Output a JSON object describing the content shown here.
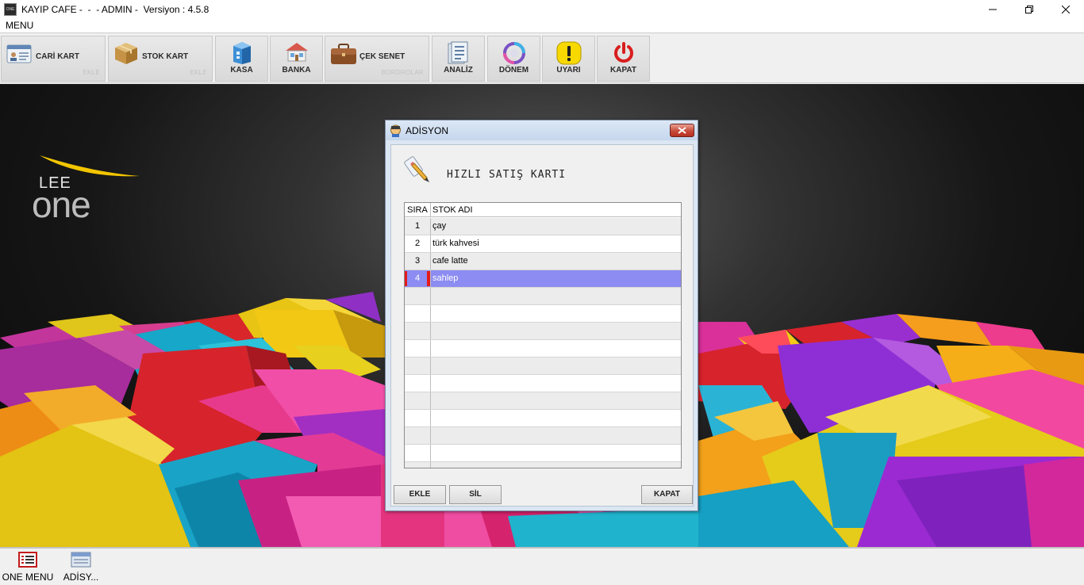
{
  "window": {
    "title": "KAYIP CAFE -  -  - ADMIN -  Versiyon : 4.5.8",
    "app_icon_text": "ONE"
  },
  "menubar": {
    "menu_label": "MENU"
  },
  "toolbar": {
    "cari_kart": {
      "label": "CARİ KART",
      "sub": "EKLE",
      "icon": "contact-card-icon"
    },
    "stok_kart": {
      "label": "STOK KART",
      "sub": "EKLE",
      "icon": "box-icon"
    },
    "kasa": {
      "label": "KASA",
      "icon": "cash-register-icon"
    },
    "banka": {
      "label": "BANKA",
      "icon": "bank-icon"
    },
    "cek_senet": {
      "label": "ÇEK SENET",
      "sub": "BORDROLAR",
      "icon": "briefcase-icon"
    },
    "analiz": {
      "label": "ANALİZ",
      "icon": "report-icon"
    },
    "donem": {
      "label": "DÖNEM",
      "icon": "period-cycle-icon"
    },
    "uyari": {
      "label": "UYARI",
      "icon": "warning-icon"
    },
    "kapat": {
      "label": "KAPAT",
      "icon": "power-icon"
    }
  },
  "logo": {
    "lee": "LEE",
    "one": "one"
  },
  "dialog": {
    "title": "ADİSYON",
    "heading": "HIZLI SATIŞ KARTI",
    "columns": {
      "sira": "SIRA",
      "stok_adi": "STOK ADI"
    },
    "rows": [
      {
        "sira": "1",
        "stok_adi": "çay"
      },
      {
        "sira": "2",
        "stok_adi": "türk kahvesi"
      },
      {
        "sira": "3",
        "stok_adi": "cafe latte"
      },
      {
        "sira": "4",
        "stok_adi": "sahlep"
      }
    ],
    "selected_row": 4,
    "buttons": {
      "ekle": "EKLE",
      "sil": "SİL",
      "kapat": "KAPAT"
    }
  },
  "taskbar": {
    "one_menu": "ONE MENU",
    "adisyon": "ADİSY..."
  },
  "colors": {
    "selection": "#8c8cf2",
    "selection_marker": "#e31b1b",
    "close_button": "#c74b3b"
  }
}
